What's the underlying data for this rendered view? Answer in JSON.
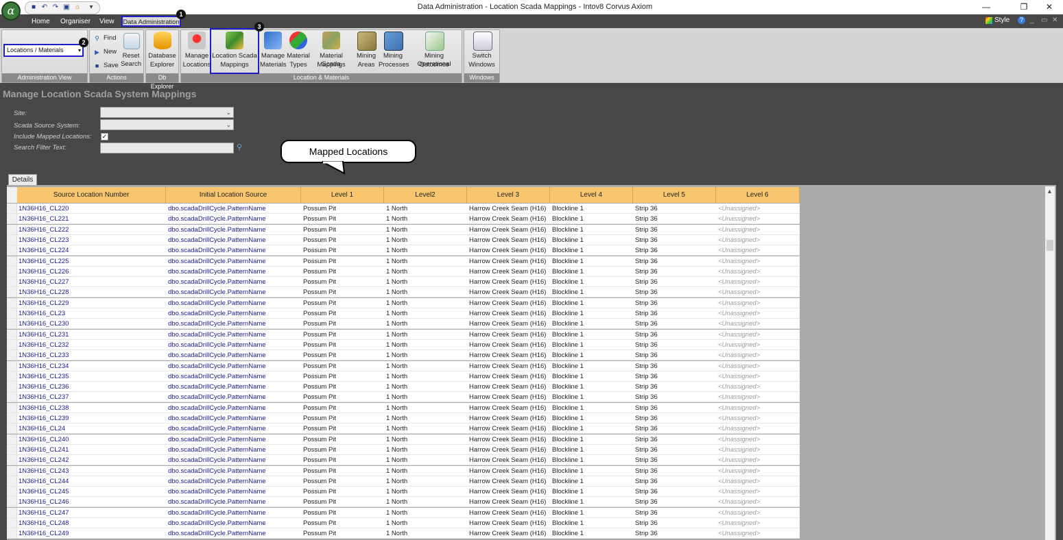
{
  "window": {
    "title": "Data Administration - Location Scada Mappings - Intov8 Corvus Axiom",
    "logo": "α"
  },
  "menu_tabs": [
    "Home",
    "Organiser",
    "View",
    "Data Administration"
  ],
  "style_label": "Style",
  "callouts": [
    "1",
    "2",
    "3"
  ],
  "ribbon": {
    "admin_view": {
      "selected": "Locations / Materials",
      "group_label": "Administration View"
    },
    "actions": {
      "find": "Find",
      "new": "New",
      "save": "Save",
      "reset_line1": "Reset",
      "reset_line2": "Search",
      "group_label": "Actions"
    },
    "db_explorer": {
      "line1": "Database",
      "line2": "Explorer",
      "group_label": "Db Explorer"
    },
    "loc_mat": {
      "buttons": [
        {
          "line1": "Manage",
          "line2": "Locations",
          "icon": "map-pin-icon"
        },
        {
          "line1": "Location Scada",
          "line2": "Mappings",
          "icon": "scada-mapping-icon"
        },
        {
          "line1": "Manage",
          "line2": "Materials",
          "icon": "materials-icon"
        },
        {
          "line1": "Material",
          "line2": "Types",
          "icon": "material-types-icon"
        },
        {
          "line1": "Material Scada",
          "line2": "Mappings",
          "icon": "material-scada-icon"
        },
        {
          "line1": "Mining",
          "line2": "Areas",
          "icon": "mining-areas-icon"
        },
        {
          "line1": "Mining",
          "line2": "Processes",
          "icon": "mining-processes-icon"
        },
        {
          "line1": "Mining Operational",
          "line2": "Outcomes",
          "icon": "outcomes-icon"
        }
      ],
      "group_label": "Location & Materials"
    },
    "windows": {
      "line1": "Switch",
      "line2": "Windows",
      "group_label": "Windows"
    }
  },
  "page": {
    "title": "Manage Location Scada System Mappings",
    "site_label": "Site:",
    "scada_label": "Scada Source System:",
    "include_label": "Include Mapped Locations:",
    "include_checked": true,
    "filter_label": "Search Filter Text:",
    "filter_value": ""
  },
  "bubble": "Mapped Locations",
  "details_tab": "Details",
  "grid": {
    "columns": [
      "Source Location Number",
      "Initial Location Source",
      "Level 1",
      "Level2",
      "Level 3",
      "Level 4",
      "Level 5",
      "Level 6"
    ],
    "rows": [
      [
        "1N36H16_CL220",
        "dbo.scadaDrillCycle.PatternName",
        "Possum Pit",
        "1 North",
        "Harrow Creek Seam (H16)",
        "Blockline 1",
        "Strip 36",
        "<Unassigned>"
      ],
      [
        "1N36H16_CL221",
        "dbo.scadaDrillCycle.PatternName",
        "Possum Pit",
        "1 North",
        "Harrow Creek Seam (H16)",
        "Blockline 1",
        "Strip 36",
        "<Unassigned>"
      ],
      [
        "1N36H16_CL222",
        "dbo.scadaDrillCycle.PatternName",
        "Possum Pit",
        "1 North",
        "Harrow Creek Seam (H16)",
        "Blockline 1",
        "Strip 36",
        "<Unassigned>"
      ],
      [
        "1N36H16_CL223",
        "dbo.scadaDrillCycle.PatternName",
        "Possum Pit",
        "1 North",
        "Harrow Creek Seam (H16)",
        "Blockline 1",
        "Strip 36",
        "<Unassigned>"
      ],
      [
        "1N36H16_CL224",
        "dbo.scadaDrillCycle.PatternName",
        "Possum Pit",
        "1 North",
        "Harrow Creek Seam (H16)",
        "Blockline 1",
        "Strip 36",
        "<Unassigned>"
      ],
      [
        "1N36H16_CL225",
        "dbo.scadaDrillCycle.PatternName",
        "Possum Pit",
        "1 North",
        "Harrow Creek Seam (H16)",
        "Blockline 1",
        "Strip 36",
        "<Unassigned>"
      ],
      [
        "1N36H16_CL226",
        "dbo.scadaDrillCycle.PatternName",
        "Possum Pit",
        "1 North",
        "Harrow Creek Seam (H16)",
        "Blockline 1",
        "Strip 36",
        "<Unassigned>"
      ],
      [
        "1N36H16_CL227",
        "dbo.scadaDrillCycle.PatternName",
        "Possum Pit",
        "1 North",
        "Harrow Creek Seam (H16)",
        "Blockline 1",
        "Strip 36",
        "<Unassigned>"
      ],
      [
        "1N36H16_CL228",
        "dbo.scadaDrillCycle.PatternName",
        "Possum Pit",
        "1 North",
        "Harrow Creek Seam (H16)",
        "Blockline 1",
        "Strip 36",
        "<Unassigned>"
      ],
      [
        "1N36H16_CL229",
        "dbo.scadaDrillCycle.PatternName",
        "Possum Pit",
        "1 North",
        "Harrow Creek Seam (H16)",
        "Blockline 1",
        "Strip 36",
        "<Unassigned>"
      ],
      [
        "1N36H16_CL23",
        "dbo.scadaDrillCycle.PatternName",
        "Possum Pit",
        "1 North",
        "Harrow Creek Seam (H16)",
        "Blockline 1",
        "Strip 36",
        "<Unassigned>"
      ],
      [
        "1N36H16_CL230",
        "dbo.scadaDrillCycle.PatternName",
        "Possum Pit",
        "1 North",
        "Harrow Creek Seam (H16)",
        "Blockline 1",
        "Strip 36",
        "<Unassigned>"
      ],
      [
        "1N36H16_CL231",
        "dbo.scadaDrillCycle.PatternName",
        "Possum Pit",
        "1 North",
        "Harrow Creek Seam (H16)",
        "Blockline 1",
        "Strip 36",
        "<Unassigned>"
      ],
      [
        "1N36H16_CL232",
        "dbo.scadaDrillCycle.PatternName",
        "Possum Pit",
        "1 North",
        "Harrow Creek Seam (H16)",
        "Blockline 1",
        "Strip 36",
        "<Unassigned>"
      ],
      [
        "1N36H16_CL233",
        "dbo.scadaDrillCycle.PatternName",
        "Possum Pit",
        "1 North",
        "Harrow Creek Seam (H16)",
        "Blockline 1",
        "Strip 36",
        "<Unassigned>"
      ],
      [
        "1N36H16_CL234",
        "dbo.scadaDrillCycle.PatternName",
        "Possum Pit",
        "1 North",
        "Harrow Creek Seam (H16)",
        "Blockline 1",
        "Strip 36",
        "<Unassigned>"
      ],
      [
        "1N36H16_CL235",
        "dbo.scadaDrillCycle.PatternName",
        "Possum Pit",
        "1 North",
        "Harrow Creek Seam (H16)",
        "Blockline 1",
        "Strip 36",
        "<Unassigned>"
      ],
      [
        "1N36H16_CL236",
        "dbo.scadaDrillCycle.PatternName",
        "Possum Pit",
        "1 North",
        "Harrow Creek Seam (H16)",
        "Blockline 1",
        "Strip 36",
        "<Unassigned>"
      ],
      [
        "1N36H16_CL237",
        "dbo.scadaDrillCycle.PatternName",
        "Possum Pit",
        "1 North",
        "Harrow Creek Seam (H16)",
        "Blockline 1",
        "Strip 36",
        "<Unassigned>"
      ],
      [
        "1N36H16_CL238",
        "dbo.scadaDrillCycle.PatternName",
        "Possum Pit",
        "1 North",
        "Harrow Creek Seam (H16)",
        "Blockline 1",
        "Strip 36",
        "<Unassigned>"
      ],
      [
        "1N36H16_CL239",
        "dbo.scadaDrillCycle.PatternName",
        "Possum Pit",
        "1 North",
        "Harrow Creek Seam (H16)",
        "Blockline 1",
        "Strip 36",
        "<Unassigned>"
      ],
      [
        "1N36H16_CL24",
        "dbo.scadaDrillCycle.PatternName",
        "Possum Pit",
        "1 North",
        "Harrow Creek Seam (H16)",
        "Blockline 1",
        "Strip 36",
        "<Unassigned>"
      ],
      [
        "1N36H16_CL240",
        "dbo.scadaDrillCycle.PatternName",
        "Possum Pit",
        "1 North",
        "Harrow Creek Seam (H16)",
        "Blockline 1",
        "Strip 36",
        "<Unassigned>"
      ],
      [
        "1N36H16_CL241",
        "dbo.scadaDrillCycle.PatternName",
        "Possum Pit",
        "1 North",
        "Harrow Creek Seam (H16)",
        "Blockline 1",
        "Strip 36",
        "<Unassigned>"
      ],
      [
        "1N36H16_CL242",
        "dbo.scadaDrillCycle.PatternName",
        "Possum Pit",
        "1 North",
        "Harrow Creek Seam (H16)",
        "Blockline 1",
        "Strip 36",
        "<Unassigned>"
      ],
      [
        "1N36H16_CL243",
        "dbo.scadaDrillCycle.PatternName",
        "Possum Pit",
        "1 North",
        "Harrow Creek Seam (H16)",
        "Blockline 1",
        "Strip 36",
        "<Unassigned>"
      ],
      [
        "1N36H16_CL244",
        "dbo.scadaDrillCycle.PatternName",
        "Possum Pit",
        "1 North",
        "Harrow Creek Seam (H16)",
        "Blockline 1",
        "Strip 36",
        "<Unassigned>"
      ],
      [
        "1N36H16_CL245",
        "dbo.scadaDrillCycle.PatternName",
        "Possum Pit",
        "1 North",
        "Harrow Creek Seam (H16)",
        "Blockline 1",
        "Strip 36",
        "<Unassigned>"
      ],
      [
        "1N36H16_CL246",
        "dbo.scadaDrillCycle.PatternName",
        "Possum Pit",
        "1 North",
        "Harrow Creek Seam (H16)",
        "Blockline 1",
        "Strip 36",
        "<Unassigned>"
      ],
      [
        "1N36H16_CL247",
        "dbo.scadaDrillCycle.PatternName",
        "Possum Pit",
        "1 North",
        "Harrow Creek Seam (H16)",
        "Blockline 1",
        "Strip 36",
        "<Unassigned>"
      ],
      [
        "1N36H16_CL248",
        "dbo.scadaDrillCycle.PatternName",
        "Possum Pit",
        "1 North",
        "Harrow Creek Seam (H16)",
        "Blockline 1",
        "Strip 36",
        "<Unassigned>"
      ],
      [
        "1N36H16_CL249",
        "dbo.scadaDrillCycle.PatternName",
        "Possum Pit",
        "1 North",
        "Harrow Creek Seam (H16)",
        "Blockline 1",
        "Strip 36",
        "<Unassigned>"
      ]
    ]
  }
}
